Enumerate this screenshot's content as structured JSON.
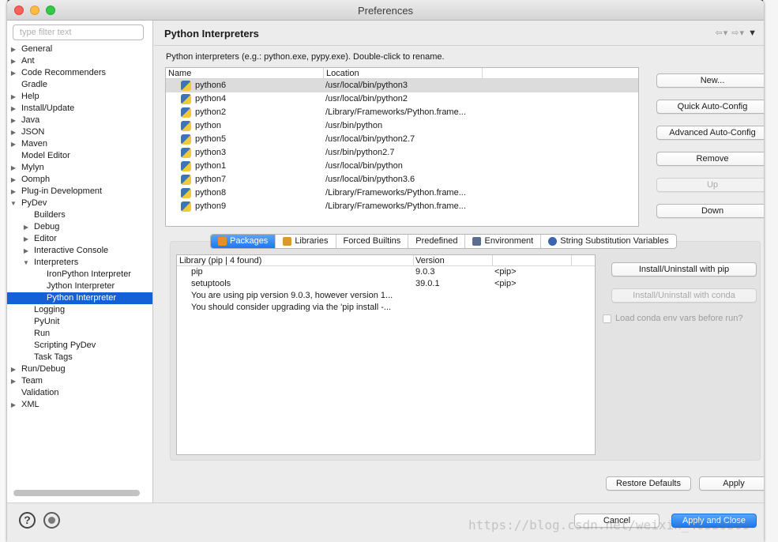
{
  "window": {
    "title": "Preferences"
  },
  "sidebar": {
    "filter_placeholder": "type filter text",
    "items": [
      {
        "label": "General",
        "level": 0,
        "arrow": "collapsed"
      },
      {
        "label": "Ant",
        "level": 0,
        "arrow": "collapsed"
      },
      {
        "label": "Code Recommenders",
        "level": 0,
        "arrow": "collapsed"
      },
      {
        "label": "Gradle",
        "level": 0,
        "arrow": "none"
      },
      {
        "label": "Help",
        "level": 0,
        "arrow": "collapsed"
      },
      {
        "label": "Install/Update",
        "level": 0,
        "arrow": "collapsed"
      },
      {
        "label": "Java",
        "level": 0,
        "arrow": "collapsed"
      },
      {
        "label": "JSON",
        "level": 0,
        "arrow": "collapsed"
      },
      {
        "label": "Maven",
        "level": 0,
        "arrow": "collapsed"
      },
      {
        "label": "Model Editor",
        "level": 0,
        "arrow": "none"
      },
      {
        "label": "Mylyn",
        "level": 0,
        "arrow": "collapsed"
      },
      {
        "label": "Oomph",
        "level": 0,
        "arrow": "collapsed"
      },
      {
        "label": "Plug-in Development",
        "level": 0,
        "arrow": "collapsed"
      },
      {
        "label": "PyDev",
        "level": 0,
        "arrow": "expanded"
      },
      {
        "label": "Builders",
        "level": 1,
        "arrow": "none"
      },
      {
        "label": "Debug",
        "level": 1,
        "arrow": "collapsed"
      },
      {
        "label": "Editor",
        "level": 1,
        "arrow": "collapsed"
      },
      {
        "label": "Interactive Console",
        "level": 1,
        "arrow": "collapsed"
      },
      {
        "label": "Interpreters",
        "level": 1,
        "arrow": "expanded"
      },
      {
        "label": "IronPython Interpreter",
        "level": 2,
        "arrow": "none"
      },
      {
        "label": "Jython Interpreter",
        "level": 2,
        "arrow": "none"
      },
      {
        "label": "Python Interpreter",
        "level": 2,
        "arrow": "none",
        "selected": true
      },
      {
        "label": "Logging",
        "level": 1,
        "arrow": "none"
      },
      {
        "label": "PyUnit",
        "level": 1,
        "arrow": "none"
      },
      {
        "label": "Run",
        "level": 1,
        "arrow": "none"
      },
      {
        "label": "Scripting PyDev",
        "level": 1,
        "arrow": "none"
      },
      {
        "label": "Task Tags",
        "level": 1,
        "arrow": "none"
      },
      {
        "label": "Run/Debug",
        "level": 0,
        "arrow": "collapsed"
      },
      {
        "label": "Team",
        "level": 0,
        "arrow": "collapsed"
      },
      {
        "label": "Validation",
        "level": 0,
        "arrow": "none"
      },
      {
        "label": "XML",
        "level": 0,
        "arrow": "collapsed"
      }
    ]
  },
  "page": {
    "title": "Python Interpreters",
    "description": "Python interpreters (e.g.: python.exe, pypy.exe).   Double-click to rename.",
    "interpreters": {
      "columns": [
        "Name",
        "Location"
      ],
      "rows": [
        {
          "name": "python6",
          "location": "/usr/local/bin/python3",
          "selected": true
        },
        {
          "name": "python4",
          "location": "/usr/local/bin/python2"
        },
        {
          "name": "python2",
          "location": "/Library/Frameworks/Python.frame..."
        },
        {
          "name": "python",
          "location": "/usr/bin/python"
        },
        {
          "name": "python5",
          "location": "/usr/local/bin/python2.7"
        },
        {
          "name": "python3",
          "location": "/usr/bin/python2.7"
        },
        {
          "name": "python1",
          "location": "/usr/local/bin/python"
        },
        {
          "name": "python7",
          "location": "/usr/local/bin/python3.6"
        },
        {
          "name": "python8",
          "location": "/Library/Frameworks/Python.frame..."
        },
        {
          "name": "python9",
          "location": "/Library/Frameworks/Python.frame..."
        }
      ]
    },
    "buttons": {
      "new": "New...",
      "quick": "Quick Auto-Config",
      "advanced": "Advanced Auto-Config",
      "remove": "Remove",
      "up": "Up",
      "down": "Down"
    },
    "tabs": [
      "Packages",
      "Libraries",
      "Forced Builtins",
      "Predefined",
      "Environment",
      "String Substitution Variables"
    ],
    "packages": {
      "columns": [
        "Library (pip | 4 found)",
        "Version",
        ""
      ],
      "rows": [
        {
          "library": "pip",
          "version": "9.0.3",
          "source": "<pip>"
        },
        {
          "library": "setuptools",
          "version": "39.0.1",
          "source": "<pip>"
        },
        {
          "library": "You are using pip version 9.0.3, however version 1...",
          "version": "",
          "source": ""
        },
        {
          "library": "You should consider upgrading via the 'pip install -...",
          "version": "",
          "source": ""
        }
      ]
    },
    "pip_buttons": {
      "install_pip": "Install/Uninstall with pip",
      "install_conda": "Install/Uninstall with conda",
      "conda_checkbox": "Load conda env vars before run?"
    },
    "restore_defaults": "Restore Defaults",
    "apply": "Apply"
  },
  "footer": {
    "cancel": "Cancel",
    "apply_close": "Apply and Close",
    "watermark": "https://blog.csdn.net/weixin_40539309"
  }
}
